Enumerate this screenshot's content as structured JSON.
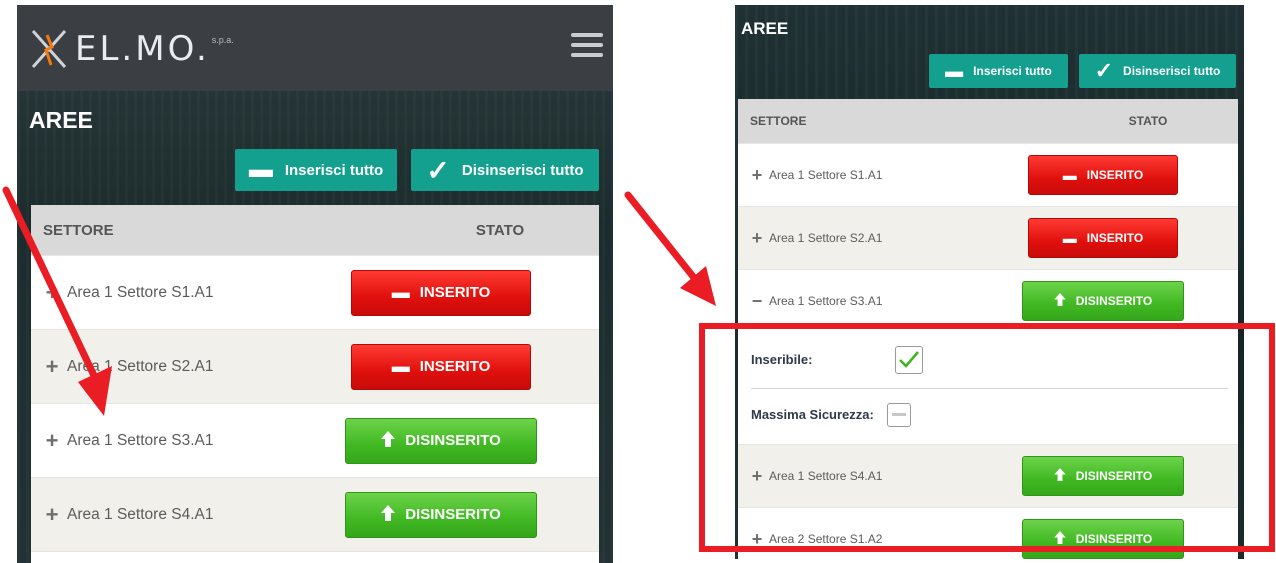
{
  "left": {
    "brand": {
      "name": "EL.MO.",
      "sub": "s.p.a."
    },
    "page_title": "AREE",
    "actions": {
      "insert_all": "Inserisci tutto",
      "disarm_all": "Disinserisci tutto"
    },
    "columns": {
      "sector": "SETTORE",
      "status": "STATO"
    },
    "rows": [
      {
        "name": "Area 1 Settore S1.A1",
        "status": "INSERITO",
        "state": "armed"
      },
      {
        "name": "Area 1 Settore S2.A1",
        "status": "INSERITO",
        "state": "armed"
      },
      {
        "name": "Area 1 Settore S3.A1",
        "status": "DISINSERITO",
        "state": "disarmed"
      },
      {
        "name": "Area 1 Settore S4.A1",
        "status": "DISINSERITO",
        "state": "disarmed"
      }
    ]
  },
  "right": {
    "page_title": "AREE",
    "actions": {
      "insert_all": "Inserisci tutto",
      "disarm_all": "Disinserisci tutto"
    },
    "columns": {
      "sector": "SETTORE",
      "status": "STATO"
    },
    "rows_top": [
      {
        "name": "Area 1 Settore S1.A1",
        "status": "INSERITO",
        "state": "armed"
      },
      {
        "name": "Area 1 Settore S2.A1",
        "status": "INSERITO",
        "state": "armed"
      },
      {
        "name": "Area 1 Settore S3.A1",
        "status": "DISINSERITO",
        "state": "disarmed"
      }
    ],
    "detail": {
      "insertable_label": "Inseribile:",
      "insertable_checked": true,
      "max_security_label": "Massima Sicurezza:",
      "max_security_checked": false
    },
    "rows_bottom": [
      {
        "name": "Area 1 Settore S4.A1",
        "status": "DISINSERITO",
        "state": "disarmed"
      },
      {
        "name": "Area 2 Settore S1.A2",
        "status": "DISINSERITO",
        "state": "disarmed"
      }
    ]
  },
  "colors": {
    "armed": "#e0100d",
    "disarmed": "#40b822",
    "teal": "#14a08f",
    "annotation": "#ea1c24"
  },
  "icons": {
    "expand": "plus-icon",
    "collapse": "minus-icon",
    "armed": "minus-icon",
    "disarmed": "arrow-up-icon",
    "check": "check-icon",
    "menu": "hamburger-icon"
  }
}
